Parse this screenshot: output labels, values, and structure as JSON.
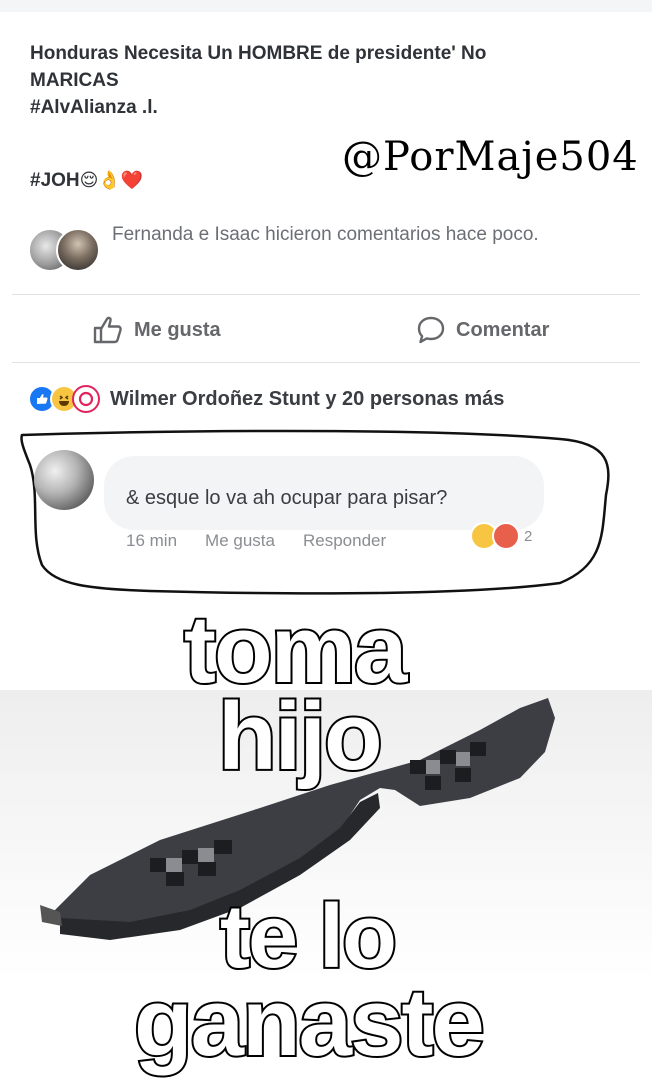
{
  "post": {
    "text_line1": "Honduras Necesita Un HOMBRE de presidente' No",
    "text_line2": "MARICAS",
    "text_line3": "#AlvAlianza .l.",
    "hashtag": "#JOH",
    "hashtag_emojis": "😌👌❤️"
  },
  "watermark": "@PorMaje504",
  "activity": {
    "text": "Fernanda e Isaac hicieron comentarios hace poco."
  },
  "actions": {
    "like_label": "Me gusta",
    "comment_label": "Comentar"
  },
  "reactions": {
    "summary": "Wilmer Ordoñez Stunt y 20 personas más"
  },
  "comment": {
    "text": "& esque lo va ah ocupar para pisar?",
    "time": "16 min",
    "like_label": "Me gusta",
    "reply_label": "Responder",
    "reaction_count": "2"
  },
  "meme": {
    "line1": "toma",
    "line2": "hijo",
    "line3": "te lo",
    "line4": "ganaste"
  },
  "colors": {
    "facebook_blue": "#1877f2",
    "haha_yellow": "#f7c542",
    "love_red": "#e0245e",
    "angry_orange": "#e8604c"
  }
}
